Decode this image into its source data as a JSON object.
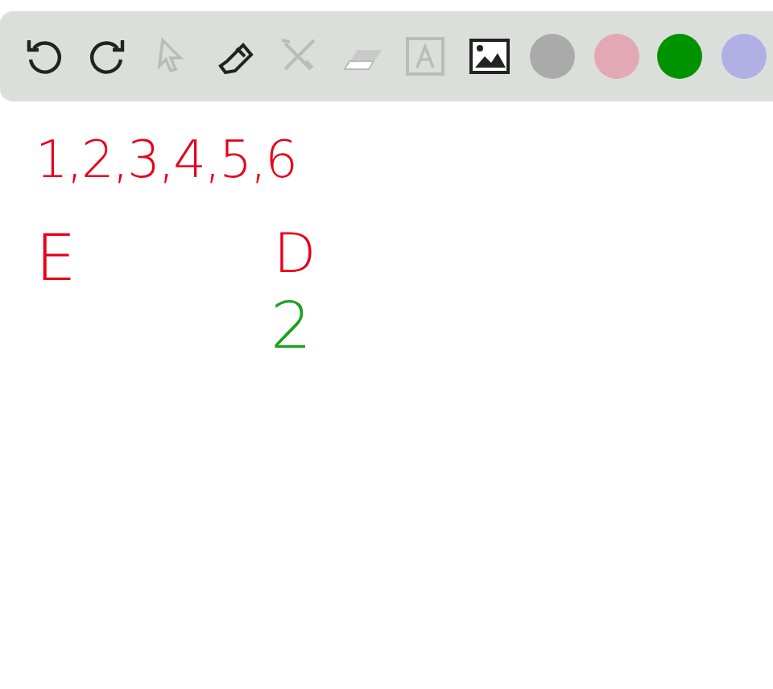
{
  "toolbar": {
    "tools": [
      {
        "kind": "undo",
        "disabled": false
      },
      {
        "kind": "redo",
        "disabled": false
      },
      {
        "kind": "select",
        "disabled": true
      },
      {
        "kind": "pen",
        "disabled": false
      },
      {
        "kind": "tools",
        "disabled": true
      },
      {
        "kind": "eraser",
        "disabled": true
      },
      {
        "kind": "text",
        "disabled": true
      },
      {
        "kind": "image",
        "disabled": false
      }
    ],
    "colors": [
      {
        "color": "#aaaaaa"
      },
      {
        "color": "#e2a8b4"
      },
      {
        "color": "#009300"
      },
      {
        "color": "#b0b0e4"
      }
    ]
  },
  "canvas": {
    "marks": [
      {
        "text": "1,2,3,4,5,6",
        "color": "#e8001c"
      },
      {
        "text": "E",
        "color": "#e8001c"
      },
      {
        "text": "D",
        "color": "#e8001c"
      },
      {
        "text": "2",
        "color": "#1ea01e"
      }
    ]
  }
}
